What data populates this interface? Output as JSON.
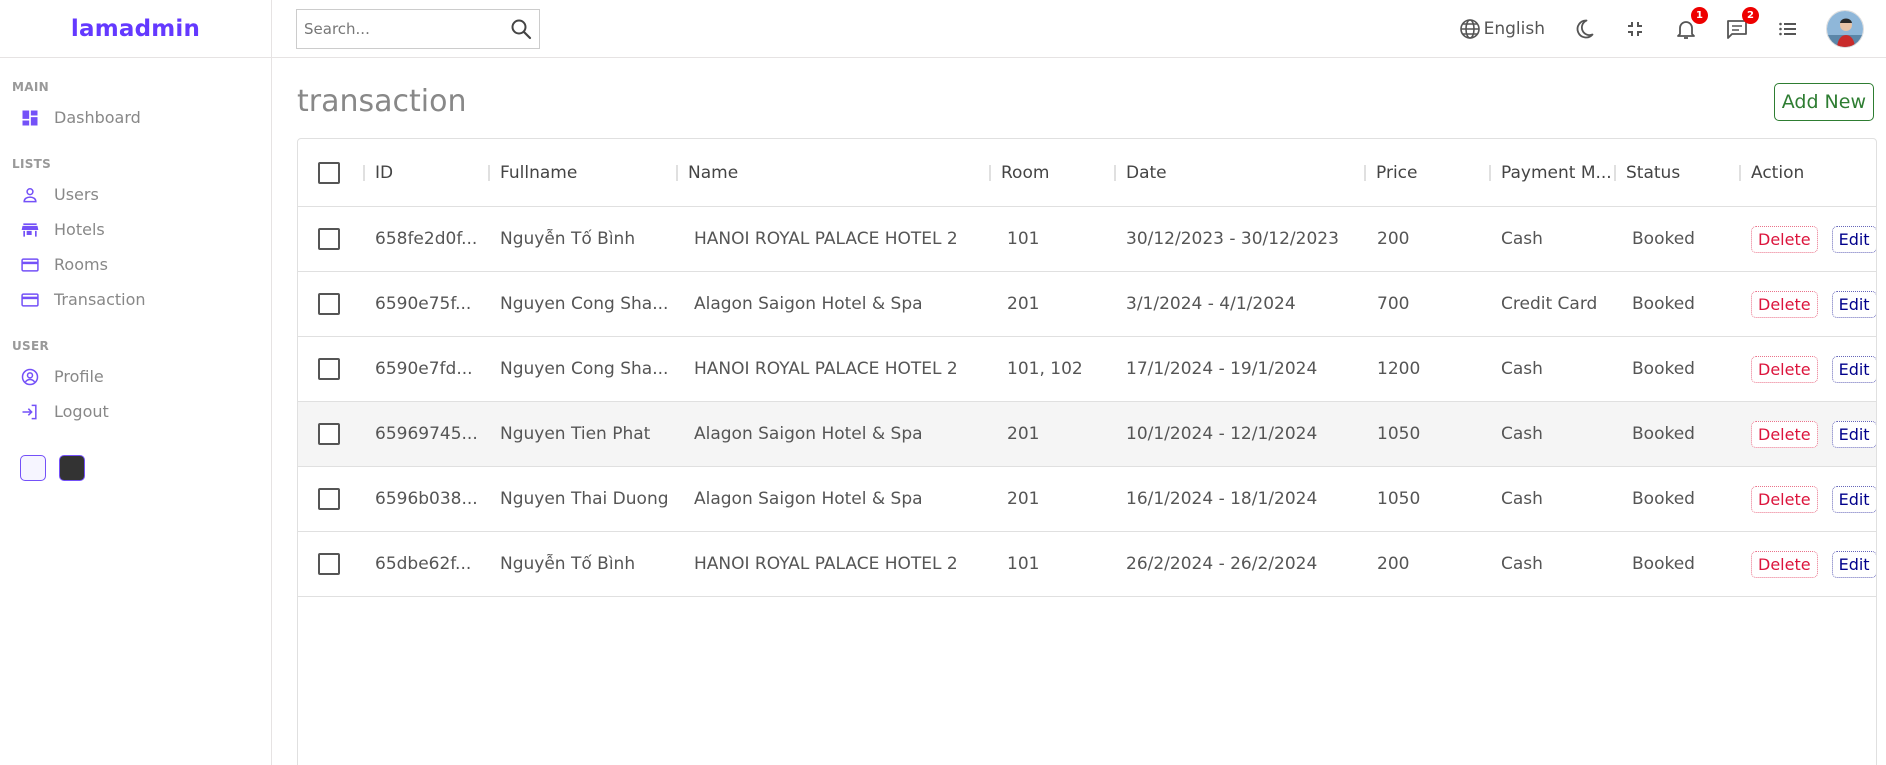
{
  "sidebar": {
    "logo": "lamadmin",
    "sections": {
      "main": {
        "title": "MAIN",
        "items": [
          "Dashboard"
        ]
      },
      "lists": {
        "title": "LISTS",
        "items": [
          "Users",
          "Hotels",
          "Rooms",
          "Transaction"
        ]
      },
      "user": {
        "title": "USER",
        "items": [
          "Profile",
          "Logout"
        ]
      }
    },
    "accent_color": "#7451f8"
  },
  "navbar": {
    "search_placeholder": "Search...",
    "language": "English",
    "notifications_count": "1",
    "messages_count": "2"
  },
  "main": {
    "title": "transaction",
    "add_label": "Add New"
  },
  "table": {
    "headers": {
      "id": "ID",
      "fullname": "Fullname",
      "name": "Name",
      "room": "Room",
      "date": "Date",
      "price": "Price",
      "payment": "Payment M...",
      "status": "Status",
      "action": "Action"
    },
    "delete_label": "Delete",
    "edit_label": "Edit",
    "rows": [
      {
        "id": "658fe2d0f...",
        "fullname": "Nguyễn Tố Bình",
        "name": "HANOI ROYAL PALACE HOTEL 2",
        "room": "101",
        "date": "30/12/2023 - 30/12/2023",
        "price": "200",
        "payment": "Cash",
        "status": "Booked"
      },
      {
        "id": "6590e75f...",
        "fullname": "Nguyen Cong Sha...",
        "name": "Alagon Saigon Hotel & Spa",
        "room": "201",
        "date": "3/1/2024 - 4/1/2024",
        "price": "700",
        "payment": "Credit Card",
        "status": "Booked"
      },
      {
        "id": "6590e7fd...",
        "fullname": "Nguyen Cong Sha...",
        "name": "HANOI ROYAL PALACE HOTEL 2",
        "room": "101, 102",
        "date": "17/1/2024 - 19/1/2024",
        "price": "1200",
        "payment": "Cash",
        "status": "Booked"
      },
      {
        "id": "65969745...",
        "fullname": "Nguyen Tien Phat",
        "name": "Alagon Saigon Hotel & Spa",
        "room": "201",
        "date": "10/1/2024 - 12/1/2024",
        "price": "1050",
        "payment": "Cash",
        "status": "Booked"
      },
      {
        "id": "6596b038...",
        "fullname": "Nguyen Thai Duong",
        "name": "Alagon Saigon Hotel & Spa",
        "room": "201",
        "date": "16/1/2024 - 18/1/2024",
        "price": "1050",
        "payment": "Cash",
        "status": "Booked"
      },
      {
        "id": "65dbe62f...",
        "fullname": "Nguyễn Tố Bình",
        "name": "HANOI ROYAL PALACE HOTEL 2",
        "room": "101",
        "date": "26/2/2024 - 26/2/2024",
        "price": "200",
        "payment": "Cash",
        "status": "Booked"
      }
    ]
  }
}
